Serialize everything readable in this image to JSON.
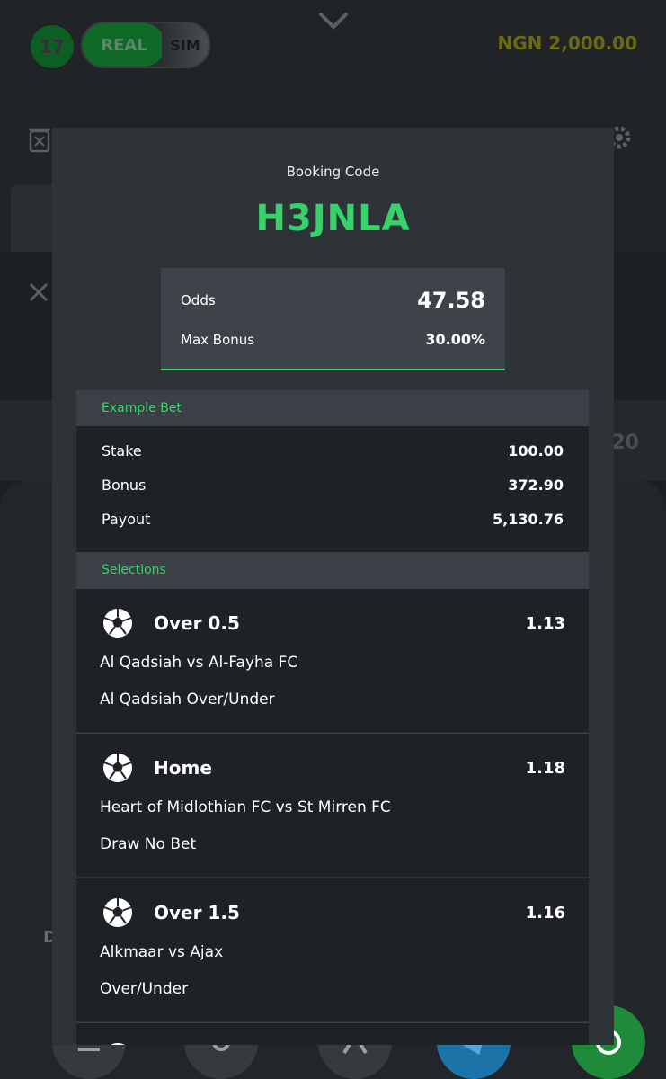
{
  "header": {
    "level_badge": "17",
    "mode_real": "REAL",
    "mode_sim": "SIM",
    "balance": "NGN 2,000.00"
  },
  "background": {
    "right_value": "20",
    "left_letter": "D"
  },
  "modal": {
    "booking_label": "Booking Code",
    "booking_code": "H3JNLA",
    "odds_label": "Odds",
    "odds_value": "47.58",
    "max_bonus_label": "Max Bonus",
    "max_bonus_value": "30.00%",
    "example_bet": {
      "title": "Example Bet",
      "rows": [
        {
          "label": "Stake",
          "value": "100.00"
        },
        {
          "label": "Bonus",
          "value": "372.90"
        },
        {
          "label": "Payout",
          "value": "5,130.76"
        }
      ]
    },
    "selections": {
      "title": "Selections",
      "items": [
        {
          "market": "Over 0.5",
          "odds": "1.13",
          "match": "Al Qadsiah vs Al-Fayha FC",
          "type": "Al Qadsiah Over/Under",
          "icon": "soccer-ball-icon"
        },
        {
          "market": "Home",
          "odds": "1.18",
          "match": "Heart of Midlothian FC vs St Mirren FC",
          "type": "Draw No Bet",
          "icon": "soccer-ball-icon"
        },
        {
          "market": "Over 1.5",
          "odds": "1.16",
          "match": "Alkmaar vs Ajax",
          "type": "Over/Under",
          "icon": "soccer-ball-icon"
        }
      ]
    }
  },
  "colors": {
    "accent_green": "#37d36a",
    "modal_bg": "#2e3338",
    "card_bg": "#1e2226",
    "telegram": "#1c73a8",
    "whatsapp": "#1e8a3a"
  }
}
